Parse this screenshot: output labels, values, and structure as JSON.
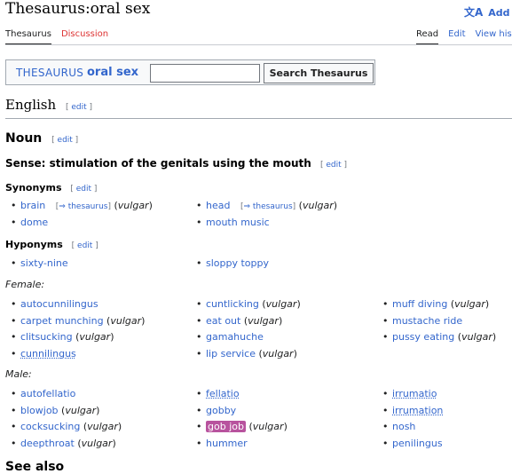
{
  "page": {
    "title": "Thesaurus:oral sex",
    "add_languages": "Add la",
    "tabs_left": [
      "Thesaurus",
      "Discussion"
    ],
    "tabs_right": [
      "Read",
      "Edit",
      "View histo"
    ]
  },
  "thesaurus_box": {
    "label": "THESAURUS",
    "term": "oral sex",
    "search_button": "Search Thesaurus",
    "search_value": ""
  },
  "edit_label": "edit",
  "english": {
    "heading": "English"
  },
  "noun": {
    "heading": "Noun"
  },
  "sense": {
    "heading": "Sense: stimulation of the genitals using the mouth"
  },
  "synonyms": {
    "heading": "Synonyms",
    "thesaurus_link": "⇒ thesaurus",
    "col1": [
      {
        "term": "brain",
        "thes": true,
        "note": "vulgar"
      },
      {
        "term": "dome",
        "thes": false,
        "note": ""
      }
    ],
    "col2": [
      {
        "term": "head",
        "thes": true,
        "note": "vulgar"
      },
      {
        "term": "mouth music",
        "thes": false,
        "note": ""
      }
    ]
  },
  "hyponyms": {
    "heading": "Hyponyms",
    "col1": [
      {
        "term": "sixty-nine",
        "note": ""
      }
    ],
    "col2": [
      {
        "term": "sloppy toppy",
        "note": ""
      }
    ]
  },
  "female": {
    "label": "Female:",
    "col1": [
      {
        "term": "autocunnilingus",
        "note": ""
      },
      {
        "term": "carpet munching",
        "note": "vulgar"
      },
      {
        "term": "clitsucking",
        "note": "vulgar"
      },
      {
        "term": "cunnilingus",
        "note": "",
        "underline": true
      }
    ],
    "col2": [
      {
        "term": "cuntlicking",
        "note": "vulgar"
      },
      {
        "term": "eat out",
        "note": "vulgar"
      },
      {
        "term": "gamahuche",
        "note": ""
      },
      {
        "term": "lip service",
        "note": "vulgar"
      }
    ],
    "col3": [
      {
        "term": "muff diving",
        "note": "vulgar"
      },
      {
        "term": "mustache ride",
        "note": ""
      },
      {
        "term": "pussy eating",
        "note": "vulgar"
      }
    ]
  },
  "male": {
    "label": "Male:",
    "col1": [
      {
        "term": "autofellatio",
        "note": ""
      },
      {
        "term": "blowjob",
        "note": "vulgar"
      },
      {
        "term": "cocksucking",
        "note": "vulgar"
      },
      {
        "term": "deepthroat",
        "note": "vulgar"
      }
    ],
    "col2": [
      {
        "term": "fellatio",
        "note": "",
        "underline": true
      },
      {
        "term": "gobby",
        "note": ""
      },
      {
        "term": "gob job",
        "note": "vulgar",
        "highlight": true
      },
      {
        "term": "hummer",
        "note": ""
      }
    ],
    "col3": [
      {
        "term": "irrumatio",
        "note": "",
        "underline": true
      },
      {
        "term": "irrumation",
        "note": "",
        "underline": true
      },
      {
        "term": "nosh",
        "note": ""
      },
      {
        "term": "penilingus",
        "note": ""
      }
    ]
  },
  "next_heading": "See also"
}
